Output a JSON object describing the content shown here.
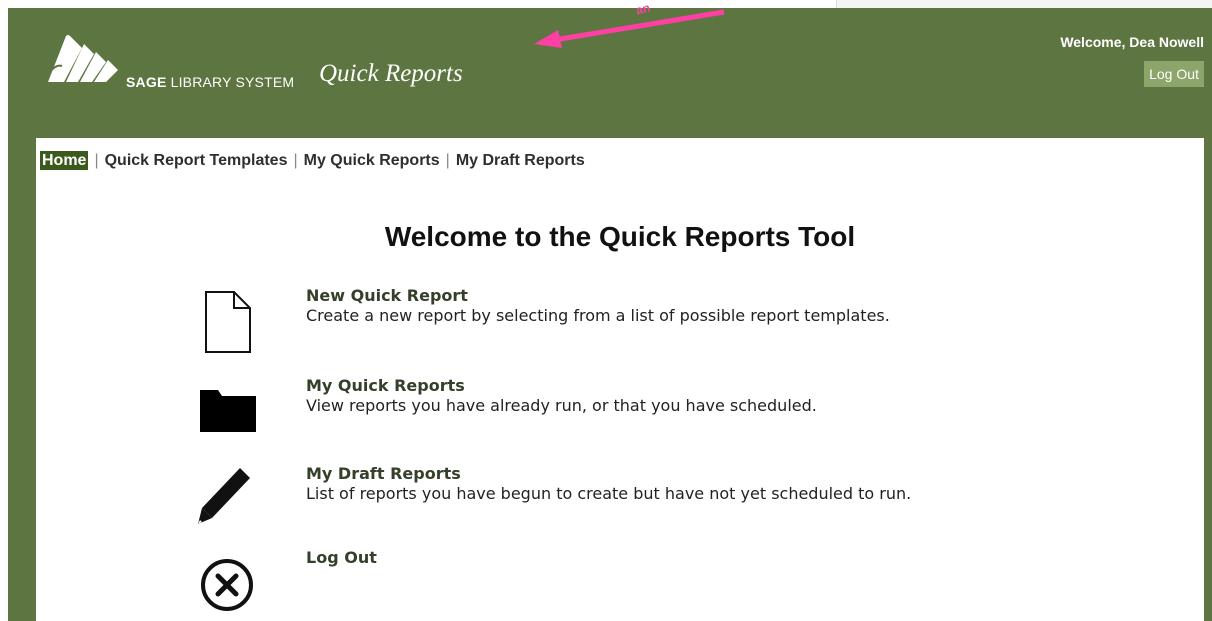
{
  "header": {
    "brand_bold": "SAGE",
    "brand_rest": "LIBRARY SYSTEM",
    "app_title": "Quick Reports",
    "welcome_text": "Welcome, Dea Nowell",
    "logout_label": "Log Out"
  },
  "nav": {
    "items": [
      {
        "label": "Home"
      },
      {
        "label": "Quick Report Templates"
      },
      {
        "label": "My Quick Reports"
      },
      {
        "label": "My Draft Reports"
      }
    ]
  },
  "main": {
    "heading": "Welcome to the Quick Reports Tool",
    "items": [
      {
        "icon": "document-icon",
        "title": "New Quick Report",
        "description": "Create a new report by selecting from a list of possible report templates."
      },
      {
        "icon": "folder-icon",
        "title": "My Quick Reports",
        "description": "View reports you have already run, or that you have scheduled."
      },
      {
        "icon": "pencil-icon",
        "title": "My Draft Reports",
        "description": "List of reports you have begun to create but have not yet scheduled to run."
      },
      {
        "icon": "close-circle-icon",
        "title": "Log Out",
        "description": ""
      }
    ]
  },
  "annotation": {
    "arrow_color": "#ff3fa4",
    "partial_label": "an"
  },
  "colors": {
    "header_green": "#5d7540",
    "home_active": "#3d5a1e",
    "logout_button": "#8ca56a"
  }
}
